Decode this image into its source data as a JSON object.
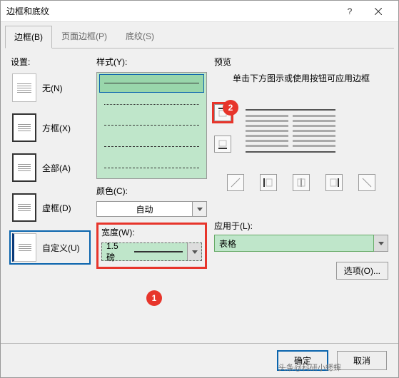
{
  "title": "边框和底纹",
  "tabs": {
    "border": "边框(B)",
    "page_border": "页面边框(P)",
    "shading": "底纹(S)"
  },
  "settings": {
    "label": "设置:",
    "none": "无(N)",
    "box": "方框(X)",
    "all": "全部(A)",
    "dashed": "虚框(D)",
    "custom": "自定义(U)"
  },
  "style": {
    "label": "样式(Y):",
    "color_label": "颜色(C):",
    "color_value": "自动",
    "width_label": "宽度(W):",
    "width_value": "1.5 磅"
  },
  "preview": {
    "label": "预览",
    "hint": "单击下方图示或使用按钮可应用边框",
    "apply_label": "应用于(L):",
    "apply_value": "表格",
    "options_btn": "选项(O)..."
  },
  "callouts": {
    "one": "1",
    "two": "2"
  },
  "footer": {
    "ok": "确定",
    "cancel": "取消"
  },
  "watermark": "头条@科研小蟋蟀"
}
